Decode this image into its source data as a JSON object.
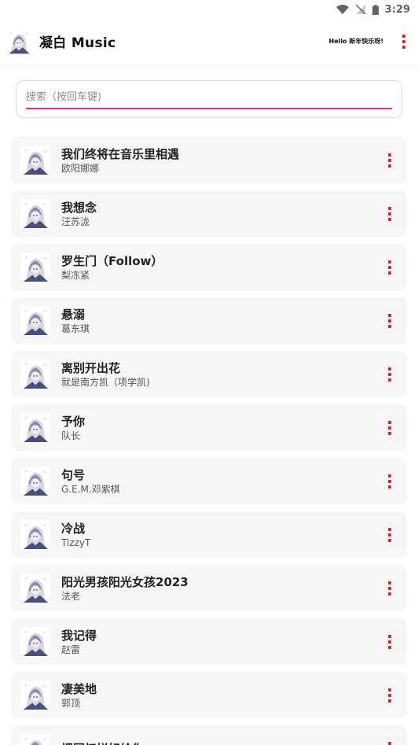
{
  "status_bar": {
    "time": "3:29",
    "icons": [
      "wifi-icon",
      "no-signal-icon",
      "battery-icon"
    ]
  },
  "app_bar": {
    "title": "凝白 Music",
    "greeting": "Hello 新年快乐呀!",
    "logo_icon": "anime-avatar-icon",
    "menu_icon": "more-vert-icon"
  },
  "search": {
    "placeholder": "搜索（按回车键)",
    "value": ""
  },
  "colors": {
    "accent": "#e4386b",
    "menu_red": "#e0242a",
    "card_bg": "#f6f6f6"
  },
  "songs": [
    {
      "title": "我们终将在音乐里相遇",
      "artist": "欧阳娜娜"
    },
    {
      "title": "我想念",
      "artist": "汪苏泷"
    },
    {
      "title": "罗生门（Follow）",
      "artist": "梨冻紧"
    },
    {
      "title": "悬溺",
      "artist": "葛东琪"
    },
    {
      "title": "离别开出花",
      "artist": "就是南方凯（项学凯)"
    },
    {
      "title": "予你",
      "artist": "队长"
    },
    {
      "title": "句号",
      "artist": "G.E.M.邓紫棋"
    },
    {
      "title": "冷战",
      "artist": "TizzyT"
    },
    {
      "title": "阳光男孩阳光女孩2023",
      "artist": "法老"
    },
    {
      "title": "我记得",
      "artist": "赵雷"
    },
    {
      "title": "凄美地",
      "artist": "郭顶"
    },
    {
      "title": "把回忆拼好给你",
      "artist": ""
    }
  ]
}
